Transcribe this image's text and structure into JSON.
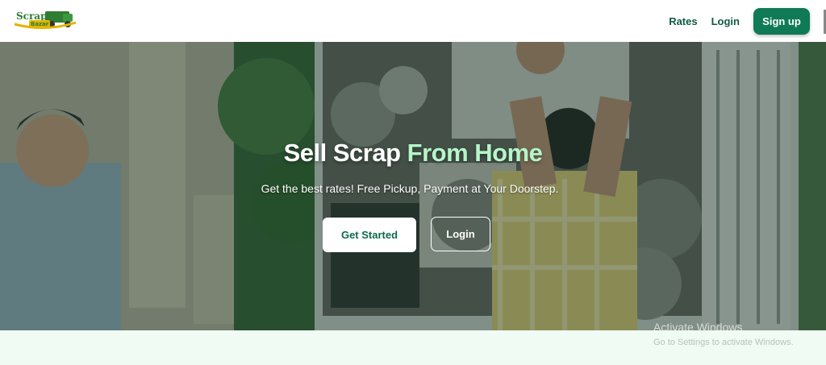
{
  "brand": {
    "logo_text": "Scrap Bazar",
    "logo_icon": "scrap-truck-logo"
  },
  "nav": {
    "rates": "Rates",
    "login": "Login",
    "signup": "Sign up"
  },
  "hero": {
    "title_main": "Sell Scrap ",
    "title_accent": "From Home",
    "subtitle": "Get the best rates! Free Pickup, Payment at Your Doorstep.",
    "get_started": "Get Started",
    "login": "Login",
    "image_desc": "people loading scrap into truck"
  },
  "os_watermark": {
    "line1": "Activate Windows",
    "line2": "Go to Settings to activate Windows."
  },
  "colors": {
    "brand_green": "#0f7a56",
    "accent_light": "#b6f5c9",
    "section_bg": "#effbf3"
  }
}
